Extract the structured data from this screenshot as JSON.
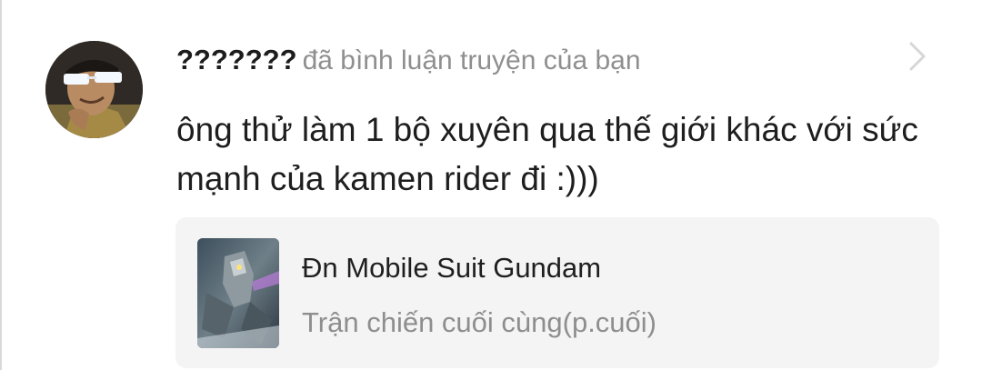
{
  "notification": {
    "username": "???????",
    "action_text": "đã bình luận truyện của bạn",
    "comment_text": "ông thử làm 1 bộ xuyên qua thế giới khác với sức mạnh của kamen rider đi :)))",
    "chevron_icon": "chevron-right-icon"
  },
  "story": {
    "title": "Đn Mobile Suit Gundam",
    "chapter": "Trận chiến cuối cùng(p.cuối)"
  },
  "colors": {
    "background": "#ffffff",
    "username": "#1c1c1c",
    "secondary_text": "#8f8f8f",
    "card_background": "#f4f4f4"
  }
}
